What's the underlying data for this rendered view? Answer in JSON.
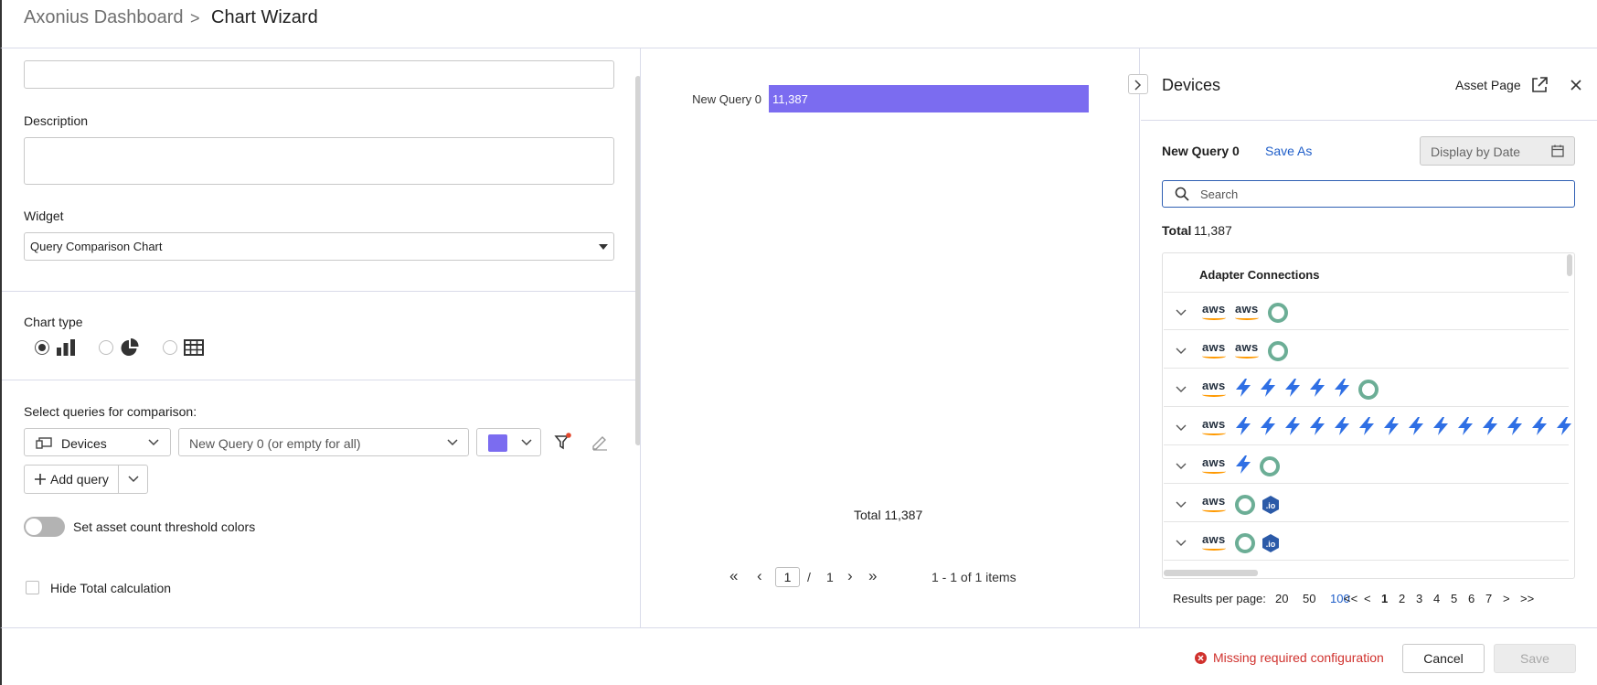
{
  "header": {
    "breadcrumb_root": "Axonius Dashboard",
    "breadcrumb_separator": ">",
    "breadcrumb_current": "Chart Wizard"
  },
  "form": {
    "name_value": "",
    "description_label": "Description",
    "description_value": "",
    "widget_label": "Widget",
    "widget_value": "Query Comparison Chart",
    "chart_type_label": "Chart type",
    "chart_type_selected": "bar",
    "select_queries_label": "Select queries for comparison:",
    "entity_value": "Devices",
    "query_placeholder": "New Query 0 (or empty for all)",
    "query_color": "#7b6cf0",
    "add_query_label": "Add query",
    "threshold_label": "Set asset count threshold colors",
    "threshold_on": false,
    "hide_total_label": "Hide Total calculation",
    "hide_total_checked": false
  },
  "chart_data": {
    "type": "bar",
    "orientation": "horizontal",
    "categories": [
      "New Query 0"
    ],
    "values": [
      11387
    ],
    "value_labels": [
      "11,387"
    ],
    "color": "#7b6cf0",
    "max": 11387,
    "total_label": "Total 11,387"
  },
  "chart_pager": {
    "page_value": "1",
    "separator": "/",
    "total_pages": "1",
    "items_text": "1 - 1 of 1 items"
  },
  "devices_panel": {
    "title": "Devices",
    "asset_page_label": "Asset Page",
    "query_name": "New Query 0",
    "save_as_label": "Save As",
    "display_by_date_placeholder": "Display by Date",
    "search_placeholder": "Search",
    "total_label": "Total",
    "total_value": "11,387",
    "column_header": "Adapter Connections",
    "rows": [
      [
        "aws",
        "aws",
        "ring"
      ],
      [
        "aws",
        "aws",
        "ring"
      ],
      [
        "aws",
        "bolt",
        "bolt",
        "bolt",
        "bolt",
        "bolt",
        "ring"
      ],
      [
        "aws",
        "bolt",
        "bolt",
        "bolt",
        "bolt",
        "bolt",
        "bolt",
        "bolt",
        "bolt",
        "bolt",
        "bolt",
        "bolt",
        "bolt",
        "bolt",
        "bolt"
      ],
      [
        "aws",
        "bolt",
        "ring"
      ],
      [
        "aws",
        "ring",
        "io"
      ],
      [
        "aws",
        "ring",
        "io"
      ]
    ],
    "results_per_page_label": "Results per page:",
    "per_page_options": [
      "20",
      "50",
      "100"
    ],
    "per_page_selected": "100",
    "page_first": "<<",
    "page_prev": "<",
    "pages": [
      "1",
      "2",
      "3",
      "4",
      "5",
      "6",
      "7"
    ],
    "page_current": "1",
    "page_next": ">",
    "page_last": ">>"
  },
  "footer": {
    "error_text": "Missing required configuration",
    "cancel_label": "Cancel",
    "save_label": "Save"
  },
  "colors": {
    "accent": "#7b6cf0",
    "link": "#1f5ec9",
    "error": "#d0312d",
    "aws_orange": "#ff9900",
    "bolt_blue": "#2f6fe4",
    "ring_green": "#6cae96"
  }
}
